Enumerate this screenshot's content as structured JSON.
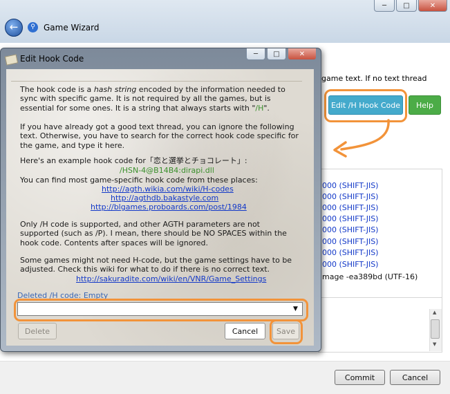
{
  "wizard": {
    "title": "Game Wizard",
    "body_text": "game text. If no text thread",
    "edit_button": "Edit /H Hook Code",
    "help_button": "Help",
    "threads": [
      "000 (SHIFT-JIS)",
      "000 (SHIFT-JIS)",
      "000 (SHIFT-JIS)",
      "000 (SHIFT-JIS)",
      "000 (SHIFT-JIS)",
      "000 (SHIFT-JIS)",
      "000 (SHIFT-JIS)",
      "000 (SHIFT-JIS)",
      "mage -ea389bd (UTF-16)"
    ],
    "commit_button": "Commit",
    "cancel_button": "Cancel"
  },
  "dialog": {
    "title": "Edit Hook Code",
    "para1_a": "The hook code is a ",
    "para1_em": "hash string",
    "para1_b": " encoded by the information needed to sync with specific game. It is not required by all the games, but is essential for some ones. It is a string that always starts with \"",
    "para1_hl": "/H",
    "para1_c": "\".",
    "para2": "If you have already got a good text thread, you can ignore the following text. Otherwise, you have to search for the correct hook code specific for the game, and type it here.",
    "example_intro": "Here's an example hook code for「恋と選挙とチョコレート」:",
    "example_code": "/HSN-4@B14B4:dirapi.dll",
    "find_text": "You can find most game-specific hook code from these places:",
    "links": [
      "http://agth.wikia.com/wiki/H-codes",
      "http://agthdb.bakastyle.com",
      "http://blgames.proboards.com/post/1984"
    ],
    "para4": "Only /H code is supported, and other AGTH parameters are not supported (such as /P). I mean, there should be NO SPACES within the hook code. Contents after spaces will be ignored.",
    "para5": "Some games might not need H-code, but the game settings have to be adjusted. Check this wiki for what to do if there is no correct text.",
    "wiki_link": "http://sakuradite.com/wiki/en/VNR/Game_Settings",
    "deleted_label": "Deleted /H code:  Empty",
    "code_value": "",
    "delete_button": "Delete",
    "cancel_button": "Cancel",
    "save_button": "Save"
  },
  "colors": {
    "annotation_orange": "#f2933a",
    "edit_button_blue": "#44aacc",
    "help_button_green": "#4cac47",
    "link_blue": "#1238c8",
    "highlight_green": "#3a8f2c"
  }
}
